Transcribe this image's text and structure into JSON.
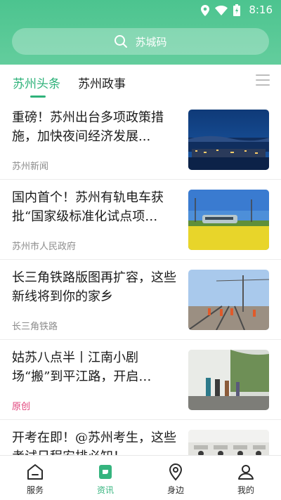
{
  "status": {
    "time": "8:16"
  },
  "search": {
    "placeholder": "苏城码"
  },
  "tabs": [
    {
      "label": "苏州头条",
      "active": true
    },
    {
      "label": "苏州政事",
      "active": false
    }
  ],
  "news": [
    {
      "title": "重磅！苏州出台多项政策措施，加快夜间经济发展...",
      "source": "苏州新闻",
      "image": "night-city-skyline"
    },
    {
      "title": "国内首个！苏州有轨电车获批“国家级标准化试点项…",
      "source": "苏州市人民政府",
      "image": "tram-in-flower-field"
    },
    {
      "title": "长三角铁路版图再扩容，这些新线将到你的家乡",
      "source": "长三角铁路",
      "image": "railway-workers"
    },
    {
      "title": "姑苏八点半丨江南小剧场“搬”到平江路，开启…",
      "source": "原创",
      "image": "alley-street-scene"
    },
    {
      "title": "开考在即！@苏州考生，这些考试日程安排必知！",
      "source": "",
      "image": "exam-hall"
    }
  ],
  "bottom_nav": [
    {
      "label": "服务",
      "icon": "home-icon",
      "active": false
    },
    {
      "label": "资讯",
      "icon": "news-icon",
      "active": true
    },
    {
      "label": "身边",
      "icon": "location-pin-icon",
      "active": false
    },
    {
      "label": "我的",
      "icon": "profile-icon",
      "active": false
    }
  ],
  "colors": {
    "accent": "#2fb27a",
    "header_top": "#4cc48f",
    "original_badge": "#e0427a"
  }
}
